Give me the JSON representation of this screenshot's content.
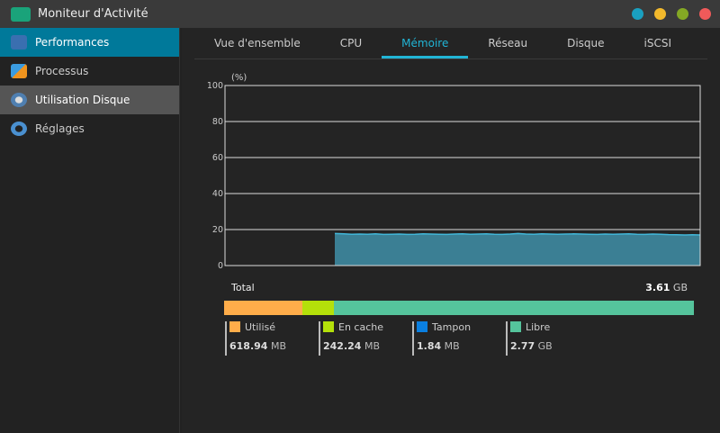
{
  "window": {
    "title": "Moniteur d'Activité",
    "controls": [
      "#1aa0c0",
      "#f2b92c",
      "#84a824",
      "#f05a5a"
    ]
  },
  "sidebar": {
    "items": [
      {
        "label": "Performances",
        "state": "active"
      },
      {
        "label": "Processus"
      },
      {
        "label": "Utilisation Disque",
        "state": "hover"
      },
      {
        "label": "Réglages"
      }
    ]
  },
  "tabs": [
    {
      "label": "Vue d'ensemble"
    },
    {
      "label": "CPU"
    },
    {
      "label": "Mémoire",
      "active": true
    },
    {
      "label": "Réseau"
    },
    {
      "label": "Disque"
    },
    {
      "label": "iSCSI"
    }
  ],
  "chart_data": {
    "type": "area",
    "ylabel": "(%)",
    "ylim": [
      0,
      100
    ],
    "yticks": [
      "0",
      "20",
      "40",
      "60",
      "80",
      "100"
    ],
    "grid": true,
    "color": "#3b7f94",
    "line_color": "#41b6d8",
    "series": [
      {
        "values": [
          null,
          null,
          null,
          null,
          null,
          null,
          null,
          null,
          null,
          null,
          null,
          null,
          null,
          null,
          17.8,
          17.6,
          17.4,
          17.5,
          17.4,
          17.6,
          17.3,
          17.4,
          17.5,
          17.3,
          17.4,
          17.6,
          17.5,
          17.4,
          17.3,
          17.5,
          17.6,
          17.4,
          17.5,
          17.6,
          17.4,
          17.3,
          17.5,
          17.8,
          17.5,
          17.4,
          17.6,
          17.5,
          17.4,
          17.5,
          17.6,
          17.5,
          17.4,
          17.3,
          17.5,
          17.4,
          17.5,
          17.6,
          17.4,
          17.3,
          17.5,
          17.4,
          17.2,
          17.1,
          17.0,
          17.1,
          17.0
        ]
      }
    ]
  },
  "memory": {
    "total_label": "Total",
    "total_value": "3.61",
    "total_unit": "GB",
    "segments": [
      {
        "label": "Utilisé",
        "value": "618.94",
        "unit": "MB",
        "color": "#ffad4a",
        "percent": 16.7
      },
      {
        "label": "En cache",
        "value": "242.24",
        "unit": "MB",
        "color": "#b4e00a",
        "percent": 6.6
      },
      {
        "label": "Tampon",
        "value": "1.84",
        "unit": "MB",
        "color": "#0a7fe0",
        "percent": 0.05
      },
      {
        "label": "Libre",
        "value": "2.77",
        "unit": "GB",
        "color": "#55c49c",
        "percent": 76.65
      }
    ]
  }
}
